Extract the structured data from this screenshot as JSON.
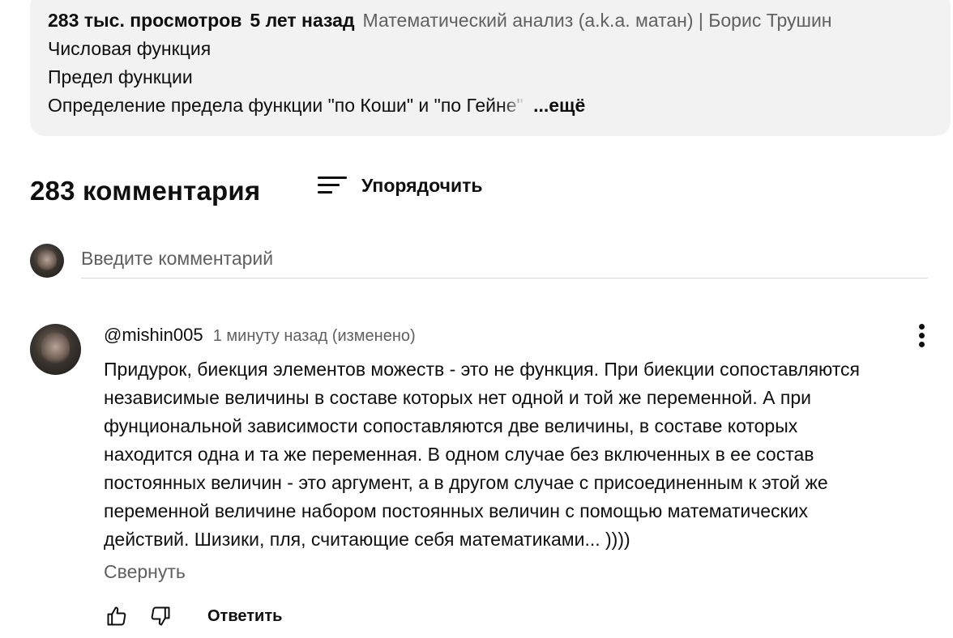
{
  "description": {
    "views": "283 тыс. просмотров",
    "age": "5 лет назад",
    "playlist": "Математический анализ (a.k.a. матан) | Борис Трушин",
    "lines": [
      "Числовая функция",
      "Предел функции"
    ],
    "last_line": "Определение предела функции \"по Коши\" и \"по Гей",
    "last_line_faded": "не\"",
    "more_label": "...ещё"
  },
  "comments": {
    "count_label": "283 комментария",
    "sort_label": "Упорядочить",
    "input_placeholder": "Введите комментарий",
    "items": [
      {
        "author": "@mishin005",
        "time": "1 минуту назад (изменено)",
        "text": "Придурок, биекция элементов можеств - это не функция. При биекции сопоставляются\nнезависимые величины в составе которых нет одной и той же переменной. А при\nфунциональной зависимости сопоставляются две величины, в составе которых\nнаходится одна и та же переменная. В одном случае без включенных в ее состав\nпостоянных величин - это аргумент, а в другом случае с присоединенным к этой же\nпеременной величине набором постоянных величин с помощью математических\nдействий. Шизики, пля, считающие себя математиками... ))))",
        "collapse_label": "Свернуть",
        "reply_label": "Ответить"
      }
    ]
  },
  "icons": {
    "sort": "sort-icon",
    "menu": "more-vert-icon",
    "like": "thumb-up-icon",
    "dislike": "thumb-down-icon"
  },
  "colors": {
    "text": "#0f0f0f",
    "secondary": "#606060",
    "description_bg": "#f2f2f2"
  }
}
